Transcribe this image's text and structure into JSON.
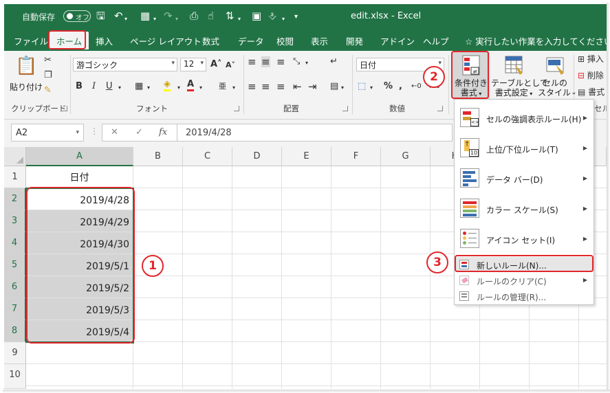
{
  "titlebar": {
    "autosave_label": "自動保存",
    "autosave_state": "オフ",
    "document_title": "edit.xlsx  -  Excel"
  },
  "tabs": [
    {
      "label": "ファイル"
    },
    {
      "label": "ホーム"
    },
    {
      "label": "挿入"
    },
    {
      "label": "ページ レイアウト"
    },
    {
      "label": "数式"
    },
    {
      "label": "データ"
    },
    {
      "label": "校閲"
    },
    {
      "label": "表示"
    },
    {
      "label": "開発"
    },
    {
      "label": "アドイン"
    },
    {
      "label": "ヘルプ"
    }
  ],
  "tell_me": "実行したい作業を入力してください",
  "ribbon": {
    "clipboard": {
      "paste_label": "貼り付け",
      "group_label": "クリップボード"
    },
    "font": {
      "font_name": "游ゴシック",
      "font_size": "12",
      "group_label": "フォント"
    },
    "alignment": {
      "group_label": "配置"
    },
    "number": {
      "format": "日付",
      "group_label": "数値"
    },
    "styles": {
      "conditional_format_line1": "条件付き",
      "conditional_format_line2": "書式",
      "format_as_table_line1": "テーブルとして",
      "format_as_table_line2": "書式設定",
      "cell_styles_line1": "セルの",
      "cell_styles_line2": "スタイル"
    },
    "cells": {
      "insert": "挿入",
      "delete": "削除",
      "format": "書式",
      "partial_label": "セル"
    }
  },
  "formula_bar": {
    "name_box": "A2",
    "formula": "2019/4/28"
  },
  "sheet": {
    "columns": [
      "A",
      "B",
      "C",
      "D",
      "E",
      "F",
      "G",
      "H"
    ],
    "rows": [
      "1",
      "2",
      "3",
      "4",
      "5",
      "6",
      "7",
      "8",
      "9",
      "10"
    ],
    "cells": {
      "A1": "日付",
      "A2": "2019/4/28",
      "A3": "2019/4/29",
      "A4": "2019/4/30",
      "A5": "2019/5/1",
      "A6": "2019/5/2",
      "A7": "2019/5/3",
      "A8": "2019/5/4"
    }
  },
  "cf_menu": {
    "items": [
      {
        "label": "セルの強調表示ルール(H)"
      },
      {
        "label": "上位/下位ルール(T)"
      },
      {
        "label": "データ バー(D)"
      },
      {
        "label": "カラー スケール(S)"
      },
      {
        "label": "アイコン セット(I)"
      },
      {
        "label": "新しいルール(N)..."
      },
      {
        "label": "ルールのクリア(C)"
      },
      {
        "label": "ルールの管理(R)..."
      }
    ],
    "top_down_icon_text": "10"
  },
  "callouts": {
    "one": "1",
    "two": "2",
    "three": "3"
  },
  "colors": {
    "excel_green": "#217346",
    "callout_red": "#e0272c",
    "selection_gray": "#d4d4d4"
  }
}
